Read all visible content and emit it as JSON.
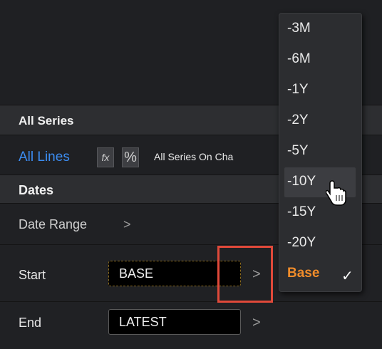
{
  "panel": {
    "all_series_header": "All Series",
    "all_lines_link": "All Lines",
    "fx_icon": "fx-icon",
    "percent_icon": "percent-icon",
    "all_series_on_chart": "All Series On Cha",
    "dates_header": "Dates",
    "date_range_label": "Date Range",
    "date_range_chevron": ">",
    "start_label": "Start",
    "start_value": "BASE",
    "end_label": "End",
    "end_value": "LATEST",
    "chevron": ">"
  },
  "dropdown": {
    "items": [
      "-3M",
      "-6M",
      "-1Y",
      "-2Y",
      "-5Y",
      "-10Y",
      "-15Y",
      "-20Y",
      "Base"
    ],
    "hovered": "-10Y",
    "selected": "Base",
    "check_glyph": "✓"
  },
  "colors": {
    "accent_link": "#3c8cf0",
    "selected_orange": "#f08c2a",
    "highlight_red": "#e0493a"
  }
}
